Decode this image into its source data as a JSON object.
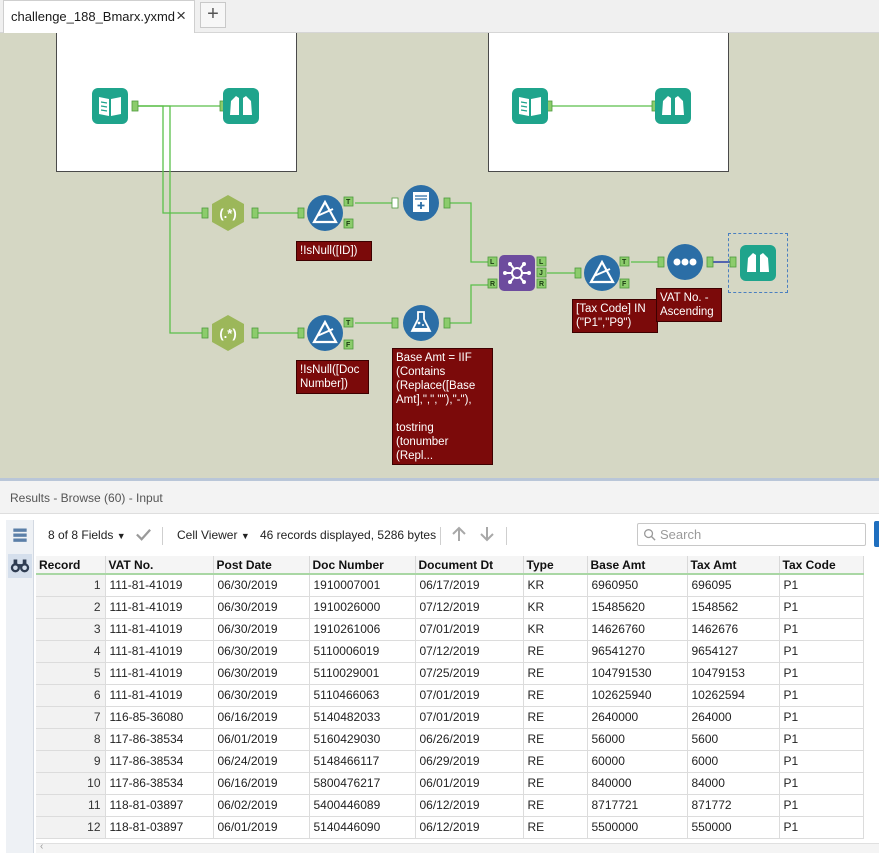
{
  "tab": {
    "title": "challenge_188_Bmarx.yxmd",
    "close_glyph": "×",
    "new_glyph": "+"
  },
  "canvas": {
    "annotations": {
      "filter1": "!IsNull([ID])",
      "filter2": "!IsNull([Doc\nNumber])",
      "formula": "Base Amt = IIF\n(Contains\n(Replace([Base\nAmt],\",\",\"\"),\"-\"),\n\ntostring\n(tonumber\n(Repl...",
      "filter3": "[Tax Code] IN\n(\"P1\",\"P9\")",
      "sort": "VAT No. -\nAscending"
    },
    "tool_icons": {
      "input": "book-icon",
      "browse": "binoculars-icon",
      "regex": "regex-icon",
      "filter": "filter-delta-icon",
      "summarize": "summarize-icon",
      "formula": "flask-icon",
      "join": "join-icon",
      "sort": "sort-dots-icon"
    },
    "anchors": {
      "true": "T",
      "false": "F",
      "left": "L",
      "join": "J",
      "right": "R"
    },
    "colors": {
      "canvas": "#d5d7c4",
      "connector": "#5bbf4a",
      "annotation": "#7b0a0a",
      "input": "#1fa48c",
      "blue_tool": "#2b6ea6",
      "purple_tool": "#6d4c9e",
      "regex": "#9cb75a"
    }
  },
  "results": {
    "title": "Results - Browse (60) - Input",
    "fields_label": "8 of 8 Fields",
    "viewer_label": "Cell Viewer",
    "records_info": "46 records displayed, 5286 bytes",
    "search_placeholder": "Search",
    "columns": [
      "Record",
      "VAT No.",
      "Post Date",
      "Doc Number",
      "Document Dt",
      "Type",
      "Base Amt",
      "Tax Amt",
      "Tax Code"
    ],
    "rows": [
      [
        "1",
        "111-81-41019",
        "06/30/2019",
        "1910007001",
        "06/17/2019",
        "KR",
        "6960950",
        "696095",
        "P1"
      ],
      [
        "2",
        "111-81-41019",
        "06/30/2019",
        "1910026000",
        "07/12/2019",
        "KR",
        "15485620",
        "1548562",
        "P1"
      ],
      [
        "3",
        "111-81-41019",
        "06/30/2019",
        "1910261006",
        "07/01/2019",
        "KR",
        "14626760",
        "1462676",
        "P1"
      ],
      [
        "4",
        "111-81-41019",
        "06/30/2019",
        "5110006019",
        "07/12/2019",
        "RE",
        "96541270",
        "9654127",
        "P1"
      ],
      [
        "5",
        "111-81-41019",
        "06/30/2019",
        "5110029001",
        "07/25/2019",
        "RE",
        "104791530",
        "10479153",
        "P1"
      ],
      [
        "6",
        "111-81-41019",
        "06/30/2019",
        "5110466063",
        "07/01/2019",
        "RE",
        "102625940",
        "10262594",
        "P1"
      ],
      [
        "7",
        "116-85-36080",
        "06/16/2019",
        "5140482033",
        "07/01/2019",
        "RE",
        "2640000",
        "264000",
        "P1"
      ],
      [
        "8",
        "117-86-38534",
        "06/01/2019",
        "5160429030",
        "06/26/2019",
        "RE",
        "56000",
        "5600",
        "P1"
      ],
      [
        "9",
        "117-86-38534",
        "06/24/2019",
        "5148466117",
        "06/29/2019",
        "RE",
        "60000",
        "6000",
        "P1"
      ],
      [
        "10",
        "117-86-38534",
        "06/16/2019",
        "5800476217",
        "06/01/2019",
        "RE",
        "840000",
        "84000",
        "P1"
      ],
      [
        "11",
        "118-81-03897",
        "06/02/2019",
        "5400446089",
        "06/12/2019",
        "RE",
        "8717721",
        "871772",
        "P1"
      ],
      [
        "12",
        "118-81-03897",
        "06/01/2019",
        "5140446090",
        "06/12/2019",
        "RE",
        "5500000",
        "550000",
        "P1"
      ]
    ]
  }
}
